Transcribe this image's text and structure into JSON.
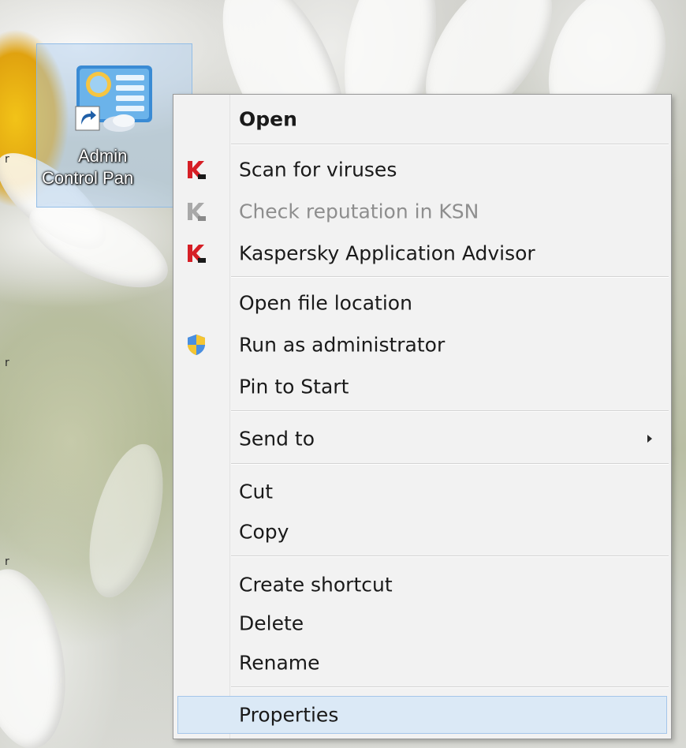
{
  "desktop": {
    "shortcut": {
      "label_line1": "Admin",
      "label_line2": "Control Pan",
      "icon": "control-panel-icon",
      "overlay": "shortcut-arrow-icon"
    }
  },
  "context_menu": {
    "items": [
      {
        "label": "Open",
        "bold": true,
        "icon": null
      },
      {
        "label": "Scan for viruses",
        "icon": "kaspersky-icon"
      },
      {
        "label": "Check reputation in KSN",
        "icon": "kaspersky-icon",
        "disabled": true
      },
      {
        "label": "Kaspersky Application Advisor",
        "icon": "kaspersky-icon"
      },
      {
        "label": "Open file location",
        "icon": null
      },
      {
        "label": "Run as administrator",
        "icon": "uac-shield-icon"
      },
      {
        "label": "Pin to Start",
        "icon": null
      },
      {
        "label": "Send to",
        "icon": null,
        "submenu": true
      },
      {
        "label": "Cut",
        "icon": null
      },
      {
        "label": "Copy",
        "icon": null
      },
      {
        "label": "Create shortcut",
        "icon": null
      },
      {
        "label": "Delete",
        "icon": null
      },
      {
        "label": "Rename",
        "icon": null
      },
      {
        "label": "Properties",
        "icon": null,
        "highlighted": true
      }
    ]
  },
  "colors": {
    "menu_background": "#f2f2f2",
    "highlight_fill": "#dbe9f6",
    "highlight_border": "#a4c6ea",
    "kaspersky_red": "#d61f26",
    "disabled_text": "#8e8e8e"
  }
}
